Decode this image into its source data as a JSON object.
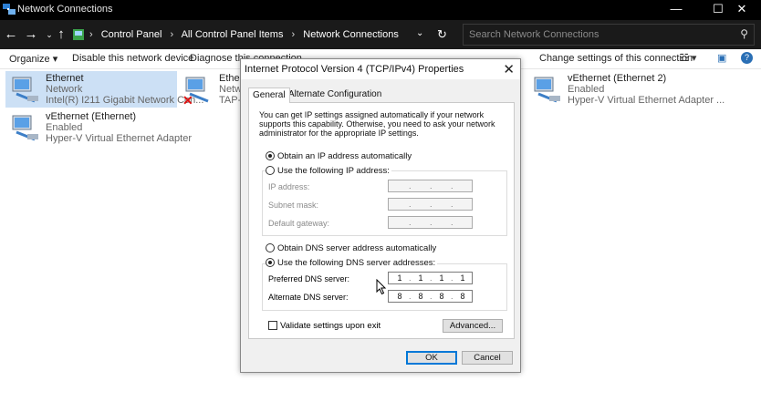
{
  "window": {
    "title": "Network Connections",
    "controls": {
      "minimize": "—",
      "maximize": "☐",
      "close": "✕"
    }
  },
  "address": {
    "breadcrumbs": [
      "Control Panel",
      "All Control Panel Items",
      "Network Connections"
    ],
    "separator": "›",
    "search_placeholder": "Search Network Connections"
  },
  "toolbar": {
    "organize": "Organize ▾",
    "disable": "Disable this network device",
    "diagnose": "Diagnose this connection",
    "change_settings": "Change settings of this connection"
  },
  "adapters": [
    {
      "name": "Ethernet",
      "status": "Network",
      "device": "Intel(R) I211 Gigabit Network Con..."
    },
    {
      "name": "Ethernet 3",
      "status": "Network cable unplugged",
      "device": "TAP-NordVPN Windows Adapter V9"
    },
    {
      "name": "vEthernet (Ethernet 2)",
      "status": "Enabled",
      "device": "Hyper-V Virtual Ethernet Adapter ..."
    },
    {
      "name": "vEthernet (Ethernet)",
      "status": "Enabled",
      "device": "Hyper-V Virtual Ethernet Adapter"
    }
  ],
  "dialog": {
    "title": "Internet Protocol Version 4 (TCP/IPv4) Properties",
    "close": "✕",
    "tabs": [
      "General",
      "Alternate Configuration"
    ],
    "info": "You can get IP settings assigned automatically if your network supports this capability. Otherwise, you need to ask your network administrator for the appropriate IP settings.",
    "ip_auto": "Obtain an IP address automatically",
    "ip_manual": "Use the following IP address:",
    "ip_address_label": "IP address:",
    "subnet_label": "Subnet mask:",
    "gateway_label": "Default gateway:",
    "dns_auto": "Obtain DNS server address automatically",
    "dns_manual": "Use the following DNS server addresses:",
    "preferred_label": "Preferred DNS server:",
    "alternate_label": "Alternate DNS server:",
    "preferred_dns": [
      "1",
      "1",
      "1",
      "1"
    ],
    "alternate_dns": [
      "8",
      "8",
      "8",
      "8"
    ],
    "validate": "Validate settings upon exit",
    "advanced": "Advanced...",
    "ok": "OK",
    "cancel": "Cancel"
  }
}
